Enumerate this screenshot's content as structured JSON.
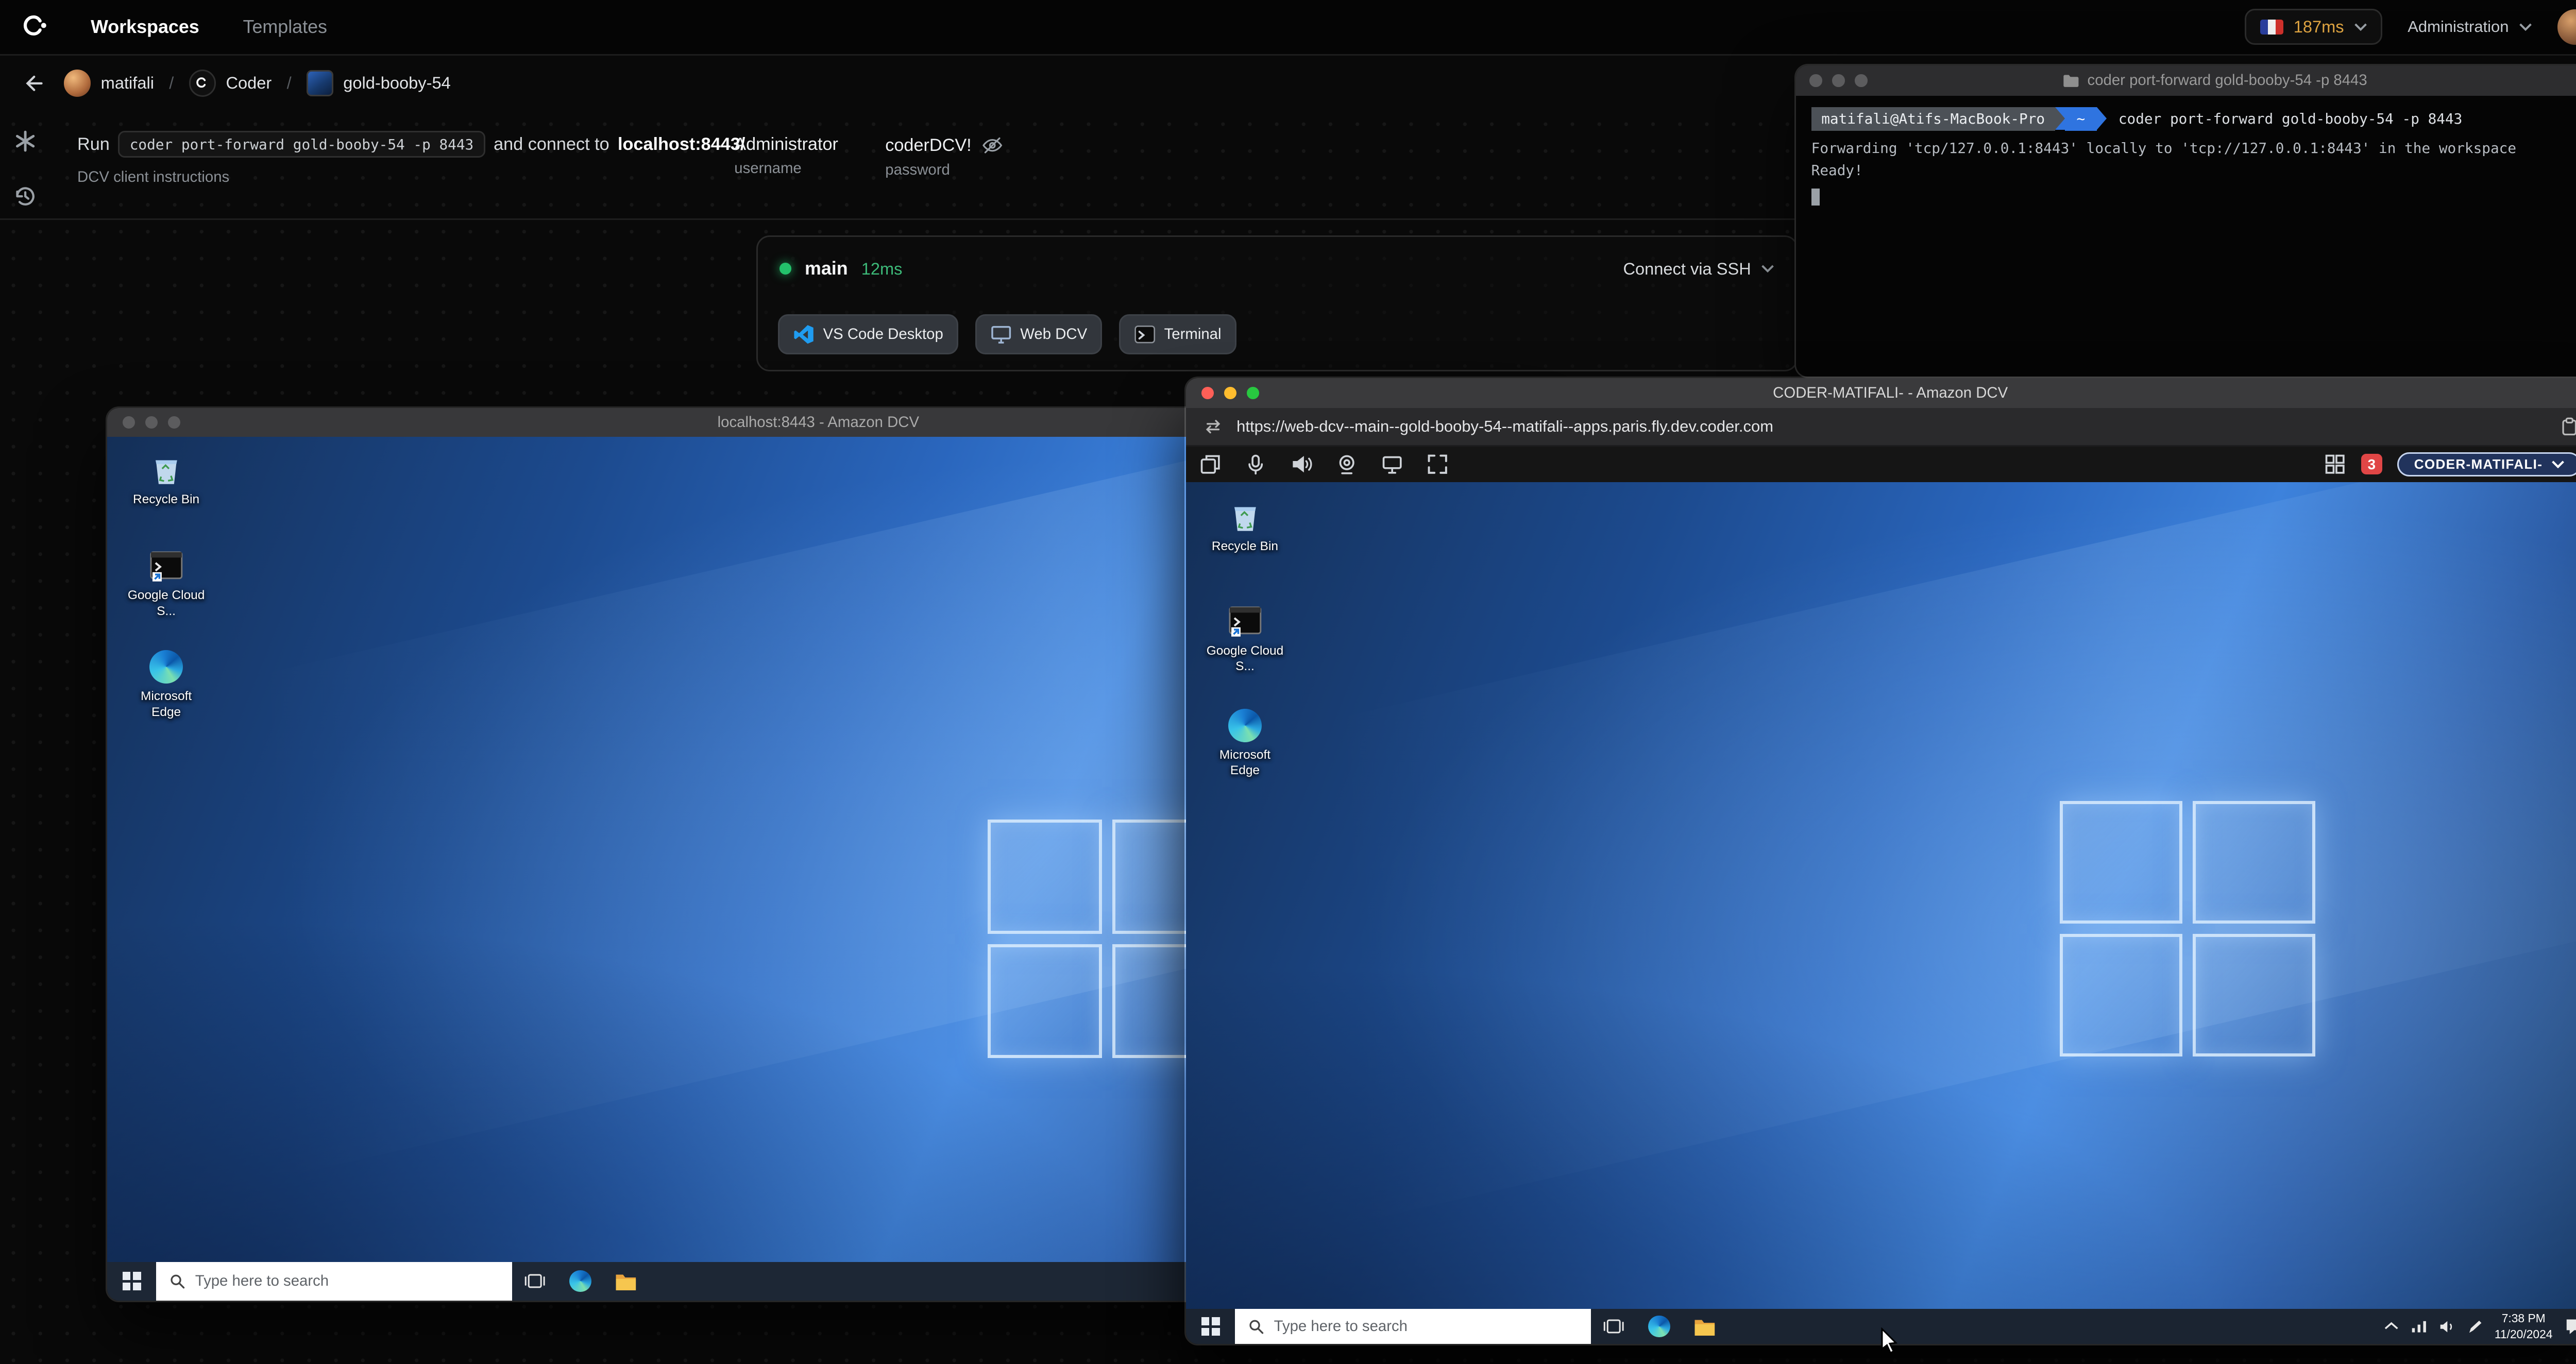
{
  "colors": {
    "page_background": "#0a0a0a",
    "accent_green": "#23c16b",
    "agent_latency_green": "#3dba79",
    "latency_amber": "#e0a542",
    "notification_red": "#e04646",
    "taskbar_blue_gray": "#1d2735",
    "wallpaper_blue": "#2a66bd",
    "terminal_prompt_blue": "#2f74e0"
  },
  "navbar": {
    "nav_items": [
      {
        "label": "Workspaces"
      },
      {
        "label": "Templates"
      }
    ],
    "latency_value": "187ms",
    "admin_label": "Administration"
  },
  "breadcrumb": {
    "separator": "/",
    "items": [
      {
        "label": "matifali"
      },
      {
        "label": "Coder"
      },
      {
        "label": "gold-booby-54"
      }
    ]
  },
  "port_forward": {
    "run_prefix": "Run",
    "command": "coder port-forward gold-booby-54 -p 8443",
    "connect_middle": "and connect to",
    "connect_target": "localhost:8443/",
    "dcv_link": "DCV client instructions",
    "credentials": {
      "username_value": "Administrator",
      "username_label": "username",
      "password_value": "coderDCV!",
      "password_label": "password"
    }
  },
  "agent": {
    "status_name": "main",
    "latency": "12ms",
    "ssh_label": "Connect via SSH",
    "app_buttons": [
      {
        "label": "VS Code Desktop"
      },
      {
        "label": "Web DCV"
      },
      {
        "label": "Terminal"
      }
    ]
  },
  "terminal": {
    "title": "coder port-forward gold-booby-54 -p 8443",
    "prompt_host": "matifali@Atifs-MacBook-Pro",
    "prompt_path": "~",
    "command": "coder port-forward gold-booby-54 -p 8443",
    "output_line1": "Forwarding 'tcp/127.0.0.1:8443' locally to 'tcp://127.0.0.1:8443' in the workspace",
    "output_line2": "Ready!"
  },
  "dcv_back": {
    "title": "localhost:8443 - Amazon DCV",
    "desktop_icons": [
      {
        "label": "Recycle Bin"
      },
      {
        "label": "Google Cloud S..."
      },
      {
        "label": "Microsoft Edge"
      }
    ],
    "search_placeholder": "Type here to search"
  },
  "dcv_front": {
    "title": "CODER-MATIFALI- - Amazon DCV",
    "url": "https://web-dcv--main--gold-booby-54--matifali--apps.paris.fly.dev.coder.com",
    "toolbar_icons": [
      "windows-session",
      "microphone",
      "speaker",
      "webcam",
      "display",
      "fullscreen"
    ],
    "notification_count": "3",
    "session_pill": "CODER-MATIFALI-",
    "desktop_icons": [
      {
        "label": "Recycle Bin"
      },
      {
        "label": "Google Cloud S..."
      },
      {
        "label": "Microsoft Edge"
      }
    ],
    "search_placeholder": "Type here to search",
    "tray": {
      "time": "7:38 PM",
      "date": "11/20/2024"
    }
  }
}
